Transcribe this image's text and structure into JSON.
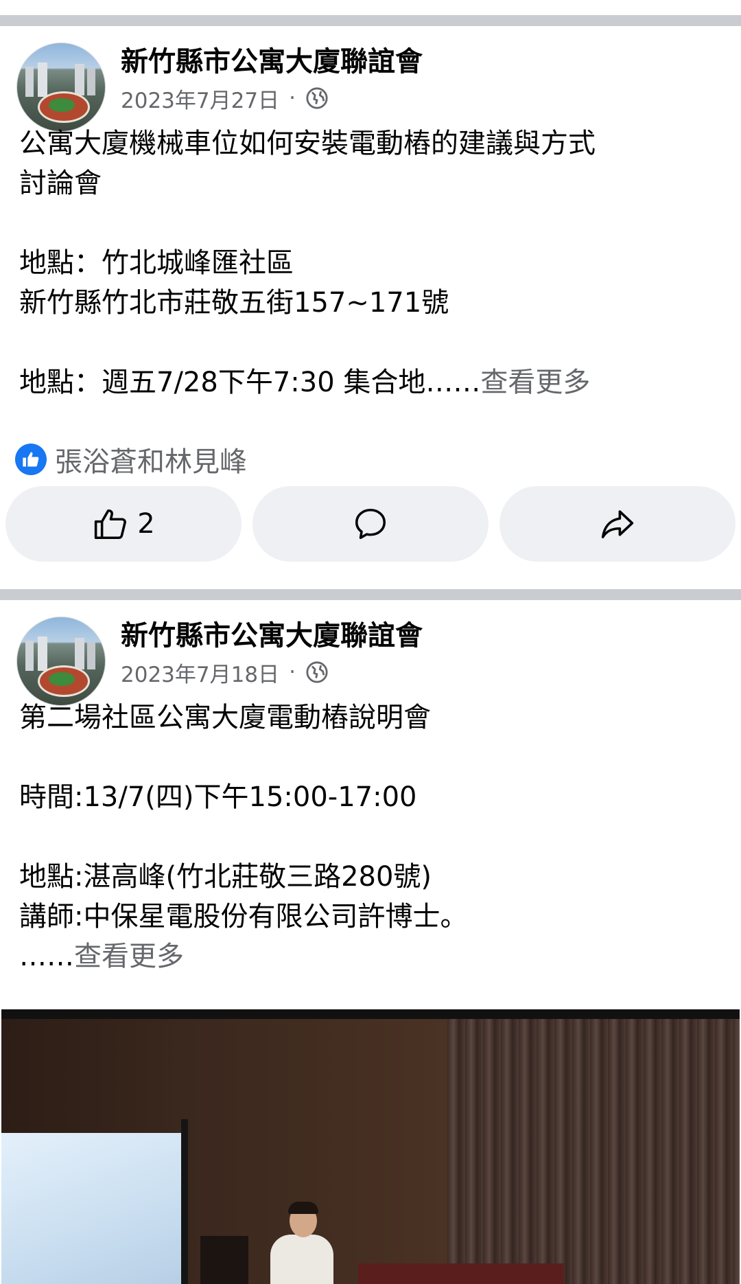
{
  "posts": [
    {
      "page_name": "新竹縣市公寓大廈聯誼會",
      "date": "2023年7月27日",
      "separator": "·",
      "text": "公寓大廈機械車位如何安裝電動樁的建議與方式\n討論會\n\n地點：竹北城峰匯社區\n新竹縣竹北市莊敬五街157~171號\n\n地點：週五7/28下午7:30 集合地……",
      "see_more": "查看更多",
      "reactions_text": "張浴蒼和林見峰",
      "like_count": "2"
    },
    {
      "page_name": "新竹縣市公寓大廈聯誼會",
      "date": "2023年7月18日",
      "separator": "·",
      "text": "第二場社區公寓大廈電動樁說明會\n\n時間:13/7(四)下午15:00-17:00\n\n地點:湛高峰(竹北莊敬三路280號)\n講師:中保星電股份有限公司許博士。\n……",
      "see_more": "查看更多"
    }
  ],
  "icons": {
    "privacy": "globe-icon",
    "reaction_badge": "like-badge-icon",
    "like": "thumbs-up-icon",
    "comment": "comment-icon",
    "share": "share-icon"
  },
  "colors": {
    "brand_blue": "#1877f2",
    "secondary_text": "#65676b",
    "divider": "#c9ccd1",
    "button_bg": "#eff0f3"
  }
}
